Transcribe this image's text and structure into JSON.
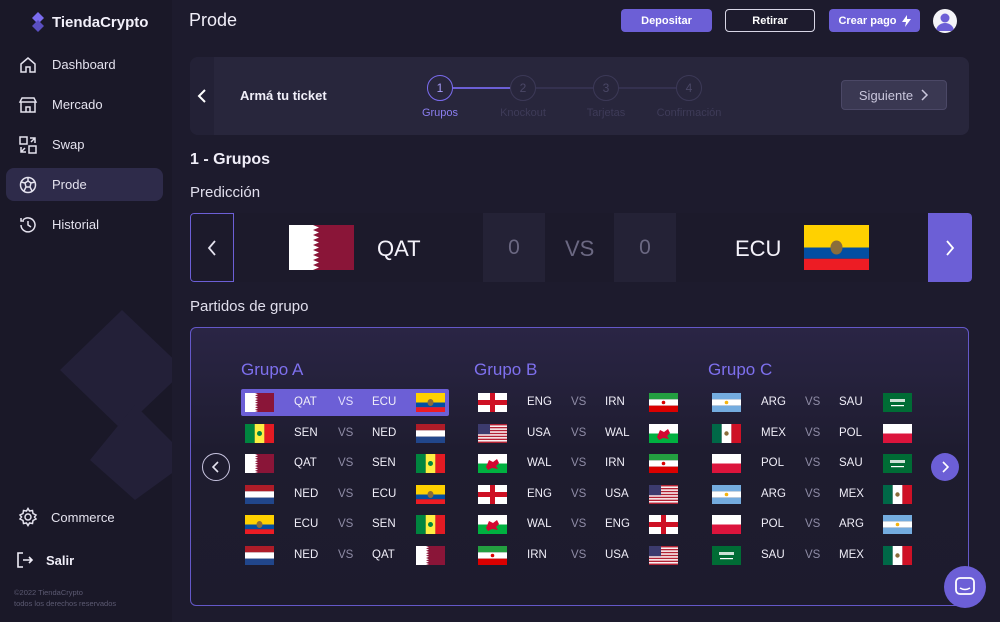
{
  "brand": {
    "name": "TiendaCrypto"
  },
  "sidebar": {
    "items": [
      {
        "label": "Dashboard",
        "icon": "home-icon"
      },
      {
        "label": "Mercado",
        "icon": "store-icon"
      },
      {
        "label": "Swap",
        "icon": "swap-icon"
      },
      {
        "label": "Prode",
        "icon": "ball-icon",
        "active": true
      },
      {
        "label": "Historial",
        "icon": "history-icon"
      }
    ],
    "commerce_label": "Commerce",
    "logout_label": "Salir",
    "copyright_line1": "©2022 TiendaCrypto",
    "copyright_line2": "todos los derechos reservados"
  },
  "header": {
    "title": "Prode",
    "depositar_label": "Depositar",
    "retirar_label": "Retirar",
    "crear_pago_label": "Crear pago"
  },
  "ticket": {
    "title": "Armá tu ticket",
    "steps": [
      {
        "number": "1",
        "label": "Grupos",
        "active": true
      },
      {
        "number": "2",
        "label": "Knockout",
        "active": false
      },
      {
        "number": "3",
        "label": "Tarjetas",
        "active": false
      },
      {
        "number": "4",
        "label": "Confirmación",
        "active": false
      }
    ],
    "next_label": "Siguiente"
  },
  "main": {
    "section_title": "1 - Grupos",
    "prediction_title": "Predicción",
    "group_matches_title": "Partidos de grupo"
  },
  "prediction": {
    "home_team": "QAT",
    "away_team": "ECU",
    "home_score": "0",
    "away_score": "0",
    "vs": "VS"
  },
  "groups": [
    {
      "title": "Grupo A",
      "matches": [
        {
          "home": "QAT",
          "away": "ECU",
          "selected": true
        },
        {
          "home": "SEN",
          "away": "NED"
        },
        {
          "home": "QAT",
          "away": "SEN"
        },
        {
          "home": "NED",
          "away": "ECU"
        },
        {
          "home": "ECU",
          "away": "SEN"
        },
        {
          "home": "NED",
          "away": "QAT"
        }
      ]
    },
    {
      "title": "Grupo B",
      "matches": [
        {
          "home": "ENG",
          "away": "IRN"
        },
        {
          "home": "USA",
          "away": "WAL"
        },
        {
          "home": "WAL",
          "away": "IRN"
        },
        {
          "home": "ENG",
          "away": "USA"
        },
        {
          "home": "WAL",
          "away": "ENG"
        },
        {
          "home": "IRN",
          "away": "USA"
        }
      ]
    },
    {
      "title": "Grupo C",
      "matches": [
        {
          "home": "ARG",
          "away": "SAU"
        },
        {
          "home": "MEX",
          "away": "POL"
        },
        {
          "home": "POL",
          "away": "SAU"
        },
        {
          "home": "ARG",
          "away": "MEX"
        },
        {
          "home": "POL",
          "away": "ARG"
        },
        {
          "home": "SAU",
          "away": "MEX"
        }
      ]
    }
  ],
  "colors": {
    "accent": "#6c5fd6",
    "background": "#1d1b2d",
    "sidebar": "#1a1828"
  }
}
